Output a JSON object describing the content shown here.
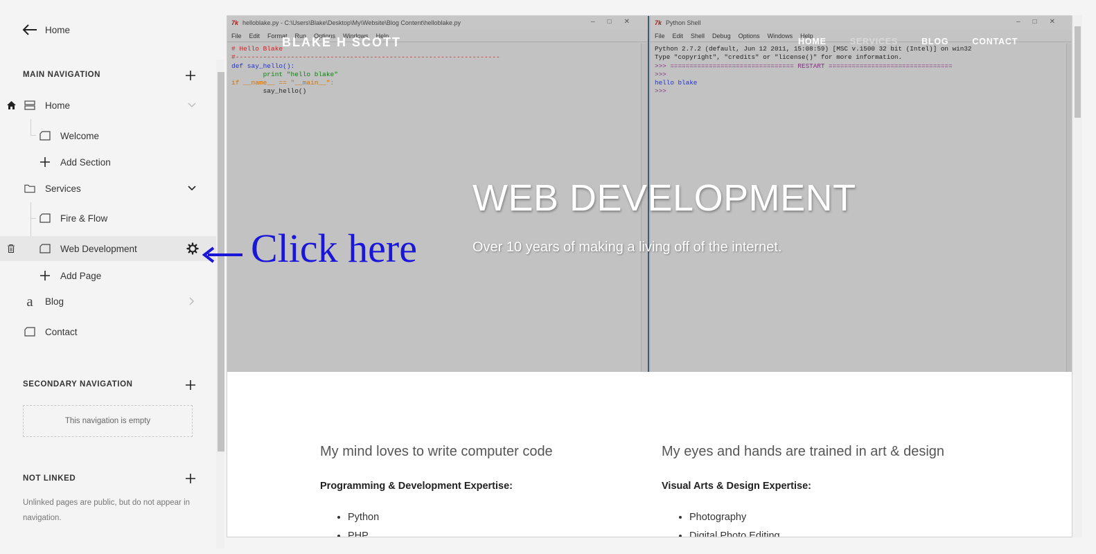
{
  "sidebar": {
    "back_label": "Home",
    "main_nav": {
      "title": "MAIN NAVIGATION",
      "items": [
        {
          "label": "Home"
        },
        {
          "label": "Welcome"
        },
        {
          "label": "Add Section"
        },
        {
          "label": "Services"
        },
        {
          "label": "Fire & Flow"
        },
        {
          "label": "Web Development"
        },
        {
          "label": "Add Page"
        },
        {
          "label": "Blog"
        },
        {
          "label": "Contact"
        }
      ]
    },
    "secondary_nav": {
      "title": "SECONDARY NAVIGATION",
      "empty_text": "This navigation is empty"
    },
    "not_linked": {
      "title": "NOT LINKED",
      "note": "Unlinked pages are public, but do not appear in navigation."
    }
  },
  "annotation": {
    "text": "Click here",
    "color": "#1a16d8"
  },
  "preview": {
    "site_title": "BLAKE H SCOTT",
    "nav": [
      "HOME",
      "SERVICES",
      "BLOG",
      "CONTACT"
    ],
    "hero_title": "WEB DEVELOPMENT",
    "hero_subtitle": "Over 10 years of making a living off of the internet.",
    "editor": {
      "title": "helloblake.py - C:\\Users\\Blake\\Desktop\\My\\Website\\Blog Content\\helloblake.py",
      "menu": [
        "File",
        "Edit",
        "Format",
        "Run",
        "Options",
        "Windows",
        "Help"
      ],
      "lines": [
        "# Hello Blake",
        "#-------------------------------------------------------------------",
        "def say_hello():",
        "        print \"hello blake\"",
        "",
        "if __name__ == \"__main__\":",
        "        say_hello()"
      ]
    },
    "shell": {
      "title": "Python Shell",
      "menu": [
        "File",
        "Edit",
        "Shell",
        "Debug",
        "Options",
        "Windows",
        "Help"
      ],
      "lines": [
        "Python 2.7.2 (default, Jun 12 2011, 15:08:59) [MSC v.1500 32 bit (Intel)] on win32",
        "Type \"copyright\", \"credits\" or \"license()\" for more information.",
        ">>> ================================ RESTART ================================",
        ">>>",
        "hello blake",
        ">>>"
      ]
    },
    "col_left": {
      "heading": "My mind loves to write computer code",
      "subheading": "Programming & Development Expertise:",
      "items": [
        "Python",
        "PHP"
      ]
    },
    "col_right": {
      "heading": "My eyes and hands are trained in art & design",
      "subheading": "Visual Arts & Design Expertise:",
      "items": [
        "Photography",
        "Digital Photo Editing"
      ]
    }
  }
}
